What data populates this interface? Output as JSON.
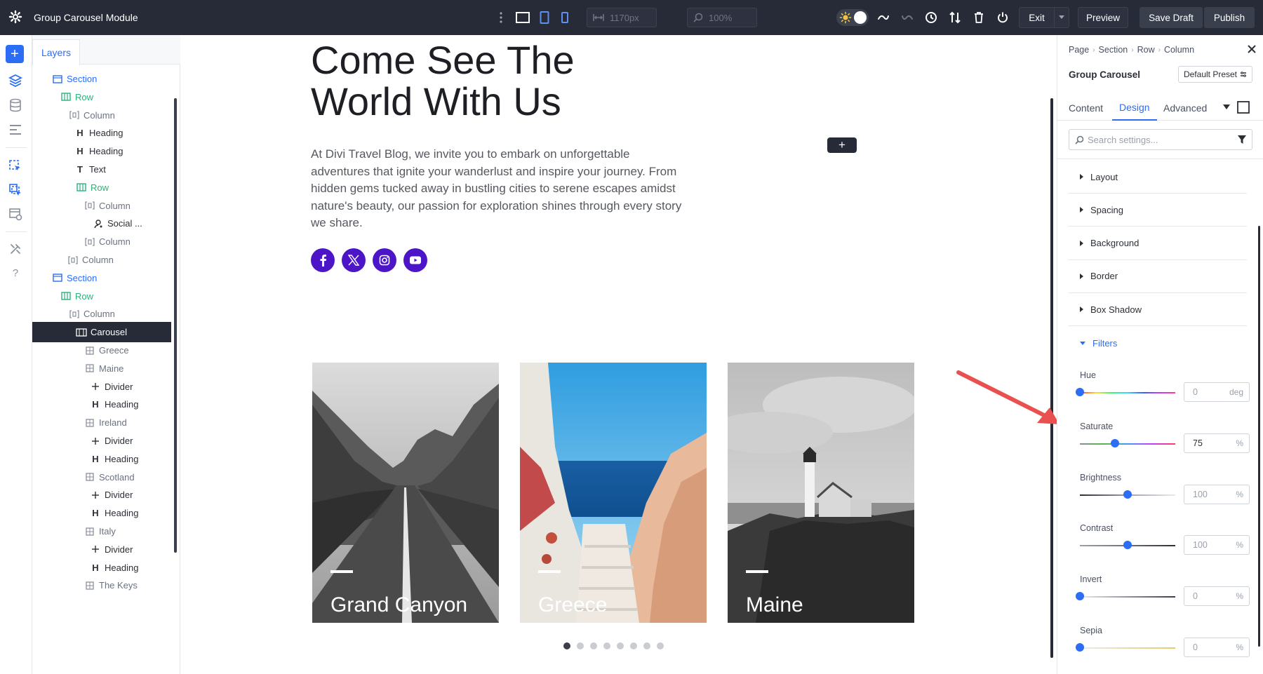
{
  "app": {
    "title": "Group Carousel Module",
    "width_field": "1170px",
    "zoom_field": "100%",
    "exit_label": "Exit",
    "preview_label": "Preview",
    "save_draft_label": "Save Draft",
    "publish_label": "Publish"
  },
  "layers": {
    "tab_label": "Layers",
    "nodes": [
      {
        "label": "Section",
        "kind": "section"
      },
      {
        "label": "Row",
        "kind": "row"
      },
      {
        "label": "Column",
        "kind": "col"
      },
      {
        "label": "Heading",
        "kind": "mod",
        "icon": "H"
      },
      {
        "label": "Heading",
        "kind": "mod",
        "icon": "H"
      },
      {
        "label": "Text",
        "kind": "mod",
        "icon": "T"
      },
      {
        "label": "Row",
        "kind": "row"
      },
      {
        "label": "Column",
        "kind": "col"
      },
      {
        "label": "Social ...",
        "kind": "mod",
        "icon": "social"
      },
      {
        "label": "Column",
        "kind": "col"
      },
      {
        "label": "Column",
        "kind": "col"
      },
      {
        "label": "Section",
        "kind": "section"
      },
      {
        "label": "Row",
        "kind": "row"
      },
      {
        "label": "Column",
        "kind": "col"
      },
      {
        "label": "Carousel",
        "kind": "sel",
        "icon": "carousel"
      },
      {
        "label": "Greece",
        "kind": "item",
        "icon": "grid"
      },
      {
        "label": "Maine",
        "kind": "item",
        "icon": "grid"
      },
      {
        "label": "Divider",
        "kind": "mod",
        "icon": "divider"
      },
      {
        "label": "Heading",
        "kind": "mod",
        "icon": "H"
      },
      {
        "label": "Ireland",
        "kind": "item",
        "icon": "grid"
      },
      {
        "label": "Divider",
        "kind": "mod",
        "icon": "divider"
      },
      {
        "label": "Heading",
        "kind": "mod",
        "icon": "H"
      },
      {
        "label": "Scotland",
        "kind": "item",
        "icon": "grid"
      },
      {
        "label": "Divider",
        "kind": "mod",
        "icon": "divider"
      },
      {
        "label": "Heading",
        "kind": "mod",
        "icon": "H"
      },
      {
        "label": "Italy",
        "kind": "item",
        "icon": "grid"
      },
      {
        "label": "Divider",
        "kind": "mod",
        "icon": "divider"
      },
      {
        "label": "Heading",
        "kind": "mod",
        "icon": "H"
      },
      {
        "label": "The Keys",
        "kind": "item",
        "icon": "grid"
      }
    ]
  },
  "canvas": {
    "hero_title_line1": "Come See The",
    "hero_title_line2": "World With Us",
    "hero_text": "At Divi Travel Blog, we invite you to embark on unforgettable adventures that ignite your wanderlust and inspire your journey. From hidden gems tucked away in bustling cities to serene escapes amidst nature's beauty, our passion for exploration shines through every story we share.",
    "socials": [
      "facebook-icon",
      "x-icon",
      "instagram-icon",
      "youtube-icon"
    ],
    "social_color": "#4c15c8",
    "cards": [
      {
        "label": "Grand Canyon"
      },
      {
        "label": "Greece"
      },
      {
        "label": "Maine"
      }
    ],
    "dots_count": 8,
    "active_dot": 0
  },
  "settings": {
    "breadcrumb": [
      "Page",
      "Section",
      "Row",
      "Column"
    ],
    "module_title": "Group Carousel",
    "preset_label": "Default Preset",
    "tabs": [
      "Content",
      "Design",
      "Advanced"
    ],
    "active_tab": "Design",
    "search_placeholder": "Search settings...",
    "groups": [
      "Layout",
      "Spacing",
      "Background",
      "Border",
      "Box Shadow",
      "Filters"
    ],
    "open_group": "Filters",
    "filters": [
      {
        "label": "Hue",
        "value": "0",
        "unit": "deg",
        "level": 0.0,
        "active": false,
        "gradient": "linear-gradient(90deg,#ff3b3b,#ffd83b,#3bff6b,#3bd6ff,#3b5bff,#c83bff,#ff3b9a)"
      },
      {
        "label": "Saturate",
        "value": "75",
        "unit": "%",
        "level": 0.37,
        "active": true,
        "gradient": "linear-gradient(90deg,#8a8f98,#5ab84a,#3b9bff,#c83bff,#ff3b6b)"
      },
      {
        "label": "Brightness",
        "value": "100",
        "unit": "%",
        "level": 0.5,
        "active": false,
        "gradient": "linear-gradient(90deg,#2b2f36,#9aa0ab,#e9ebee)"
      },
      {
        "label": "Contrast",
        "value": "100",
        "unit": "%",
        "level": 0.5,
        "active": false,
        "gradient": "linear-gradient(90deg,#9aa0ab,#6b7280,#2b2f36)"
      },
      {
        "label": "Invert",
        "value": "0",
        "unit": "%",
        "level": 0.0,
        "active": false,
        "gradient": "linear-gradient(90deg,#e9ebee,#3a3f4d)"
      },
      {
        "label": "Sepia",
        "value": "0",
        "unit": "%",
        "level": 0.0,
        "active": false,
        "gradient": "linear-gradient(90deg,#e9ebee,#e8c96b)"
      }
    ]
  },
  "colors": {
    "accent": "#2b6df5",
    "topbar": "#272b37",
    "row_green": "#2ab37a",
    "arrow": "#e8514f"
  }
}
